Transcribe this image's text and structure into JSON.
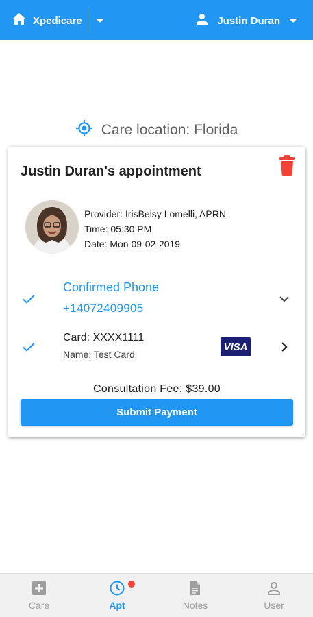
{
  "header": {
    "app_title": "Xpedicare",
    "user_name": "Justin Duran"
  },
  "care_location": {
    "text": "Care location: Florida"
  },
  "appointment": {
    "title": "Justin Duran's appointment",
    "provider": "Provider: IrisBelsy Lomelli, APRN",
    "time": "Time: 05:30 PM",
    "date": "Date: Mon 09-02-2019"
  },
  "phone": {
    "title": "Confirmed Phone",
    "number": "+14072409905"
  },
  "payment_card": {
    "number": "Card: XXXX1111",
    "name": "Name: Test Card",
    "brand": "VISA"
  },
  "fee": "Consultation Fee: $39.00",
  "submit_label": "Submit Payment",
  "bottom_nav": [
    {
      "label": "Care",
      "icon": "medical-plus-icon"
    },
    {
      "label": "Apt",
      "icon": "clock-icon"
    },
    {
      "label": "Notes",
      "icon": "document-icon"
    },
    {
      "label": "User",
      "icon": "person-icon"
    }
  ],
  "colors": {
    "primary": "#2196f3",
    "danger": "#f44336",
    "visa": "#1a1f71"
  }
}
